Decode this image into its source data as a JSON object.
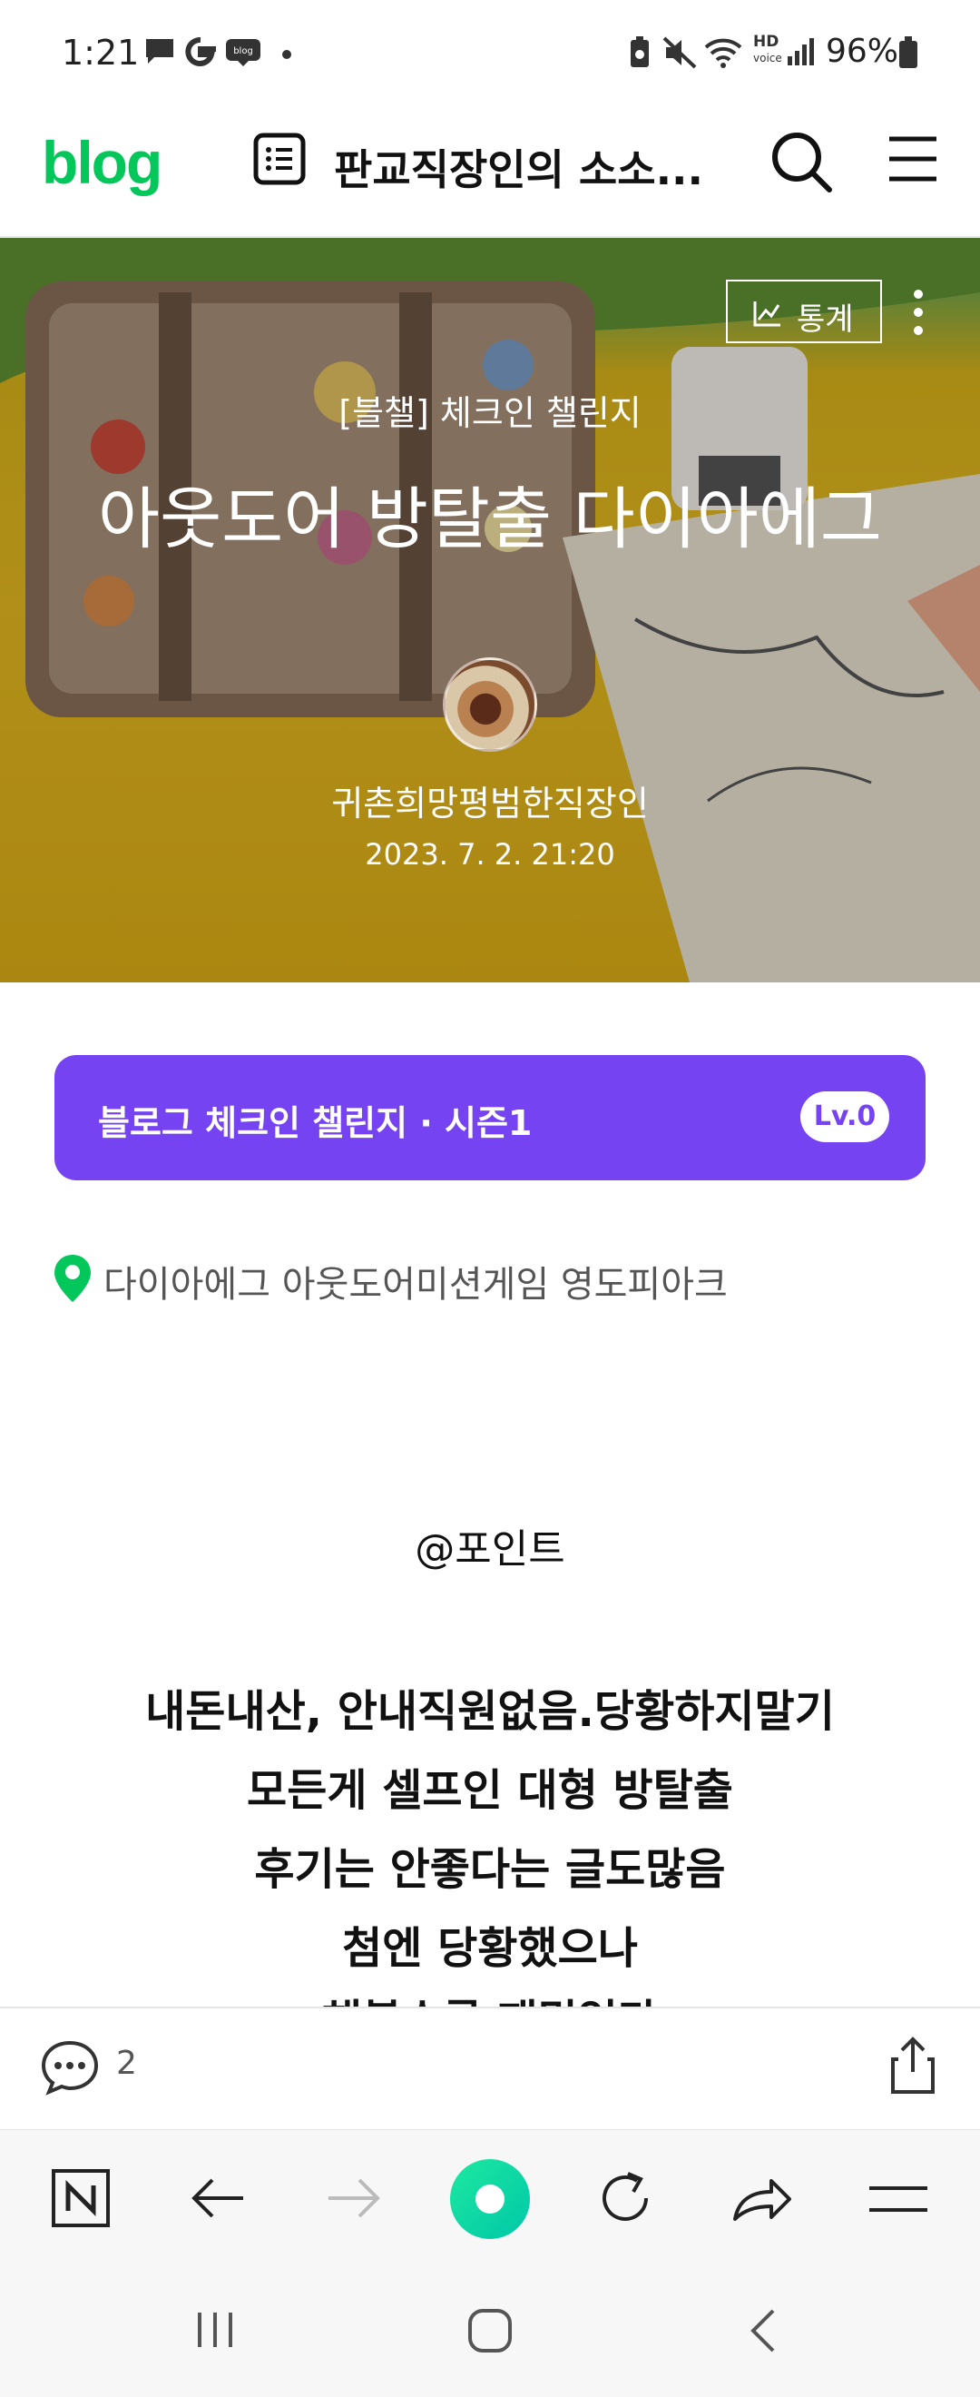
{
  "status_bar": {
    "time": "1:21",
    "battery": "96%",
    "icons": [
      "message-icon",
      "google-icon",
      "blog-icon",
      "dot-icon",
      "battery-saver-icon",
      "mute-icon",
      "wifi-icon",
      "hd-voice-icon",
      "signal-icon",
      "battery-icon"
    ],
    "hd_label": "HD",
    "voice_label": "voice"
  },
  "header": {
    "logo": "blog",
    "title": "판교직장인의 소소...",
    "icons": [
      "list-icon",
      "search-icon",
      "menu-icon"
    ]
  },
  "hero": {
    "stats_label": "통계",
    "category": "[블챌] 체크인 챌린지",
    "title": "아웃도어 방탈출 다이아에그",
    "author": "귀촌희망평범한직장인",
    "date": "2023. 7. 2. 21:20"
  },
  "challenge": {
    "label": "블로그 체크인 챌린지 · 시즌1",
    "level": "Lv.0"
  },
  "location": {
    "text": "다이아에그 아웃도어미션게임 영도피아크"
  },
  "body": {
    "point": "@포인트",
    "lines": [
      "내돈내산, 안내직원없음.당황하지말기",
      "모든게 셀프인 대형 방탈출",
      "후기는 안좋다는 글도많음",
      "첨엔 당황했으나",
      "해볼수록 재밌었다"
    ]
  },
  "comment_bar": {
    "count": "2"
  },
  "colors": {
    "brand_green": "#03c75a",
    "challenge_purple": "#7543f2"
  }
}
